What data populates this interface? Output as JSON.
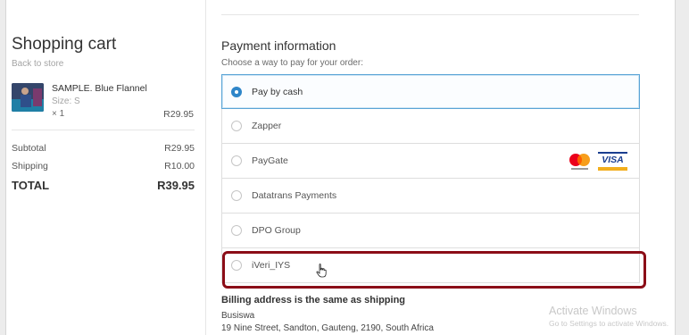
{
  "cart": {
    "title": "Shopping cart",
    "back_link": "Back to store",
    "item": {
      "name": "SAMPLE. Blue Flannel",
      "size": "Size: S",
      "quantity": "× 1",
      "price": "R29.95"
    },
    "subtotal_label": "Subtotal",
    "subtotal_value": "R29.95",
    "shipping_label": "Shipping",
    "shipping_value": "R10.00",
    "total_label": "TOTAL",
    "total_value": "R39.95"
  },
  "payment": {
    "heading": "Payment information",
    "subheading": "Choose a way to pay for your order:",
    "methods": [
      {
        "label": "Pay by cash",
        "selected": true
      },
      {
        "label": "Zapper",
        "selected": false
      },
      {
        "label": "PayGate",
        "selected": false,
        "card_logos": [
          "mastercard-logo",
          "visa-logo"
        ]
      },
      {
        "label": "Datatrans Payments",
        "selected": false
      },
      {
        "label": "DPO Group",
        "selected": false
      },
      {
        "label": "iVeri_IYS",
        "selected": false,
        "highlighted": true
      }
    ],
    "visa_text": "VISA"
  },
  "billing": {
    "heading": "Billing address is the same as shipping",
    "name": "Busiswa",
    "address": "19 Nine Street, Sandton, Gauteng, 2190, South Africa"
  },
  "watermark": {
    "title": "Activate Windows",
    "subtitle": "Go to Settings to activate Windows."
  },
  "colors": {
    "accent": "#2f86c9",
    "highlight_outline": "#8b0d17"
  }
}
